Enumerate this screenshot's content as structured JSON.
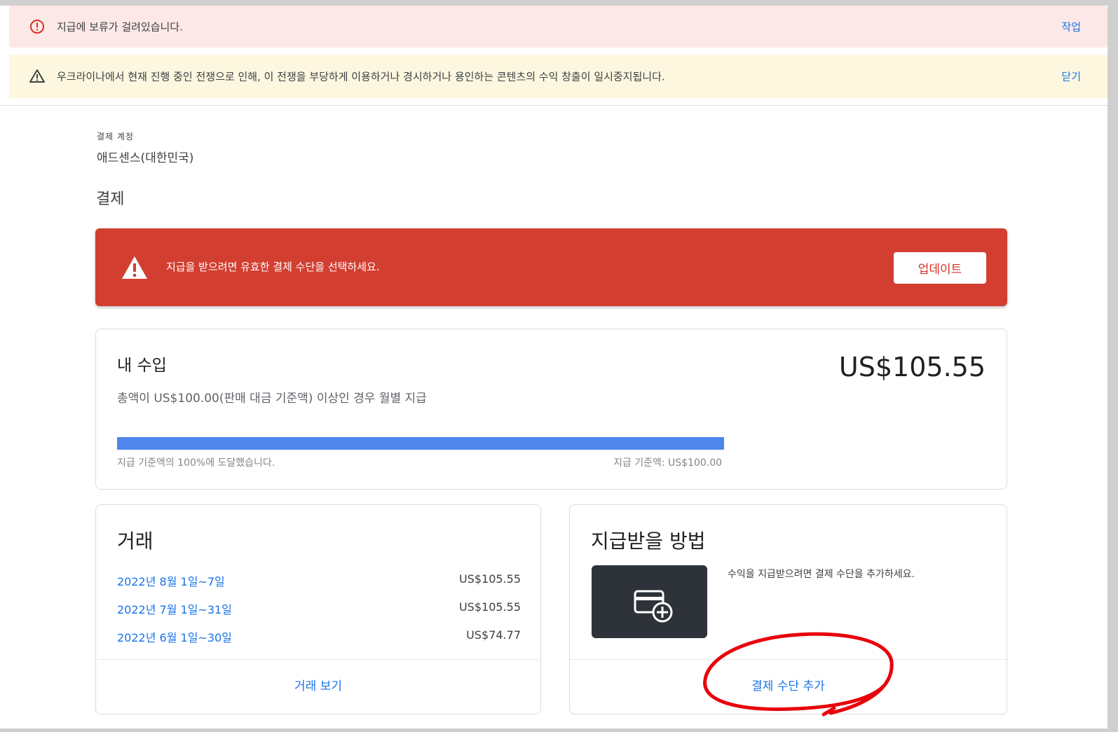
{
  "banners": {
    "error": {
      "text": "지급에 보류가 걸려있습니다.",
      "action": "작업",
      "icon": "error-circle-icon"
    },
    "warning": {
      "text": "우크라이나에서 현재 진행 중인 전쟁으로 인해, 이 전쟁을 부당하게 이용하거나 경시하거나 용인하는 콘텐츠의 수익 창출이 일시중지됩니다.",
      "action": "닫기",
      "icon": "warning-triangle-icon"
    }
  },
  "account": {
    "label": "결제 계정",
    "name": "애드센스(대한민국)"
  },
  "section_title": "결제",
  "alert": {
    "text": "지급을 받으려면 유효한 결제 수단을 선택하세요.",
    "button": "업데이트",
    "color": "#d23f31"
  },
  "earnings": {
    "title": "내 수입",
    "amount": "US$105.55",
    "description": "총액이 US$100.00(판매 대금 기준액) 이상인 경우 월별 지급",
    "progress_percent": 100,
    "progress_left": "지급 기준액의 100%에 도달했습니다.",
    "progress_right": "지급 기준액: US$100.00",
    "bar_color": "#4f86ec"
  },
  "transactions": {
    "title": "거래",
    "rows": [
      {
        "period": "2022년 8월 1일~7일",
        "amount": "US$105.55"
      },
      {
        "period": "2022년 7월 1일~31일",
        "amount": "US$105.55"
      },
      {
        "period": "2022년 6월 1일~30일",
        "amount": "US$74.77"
      }
    ],
    "footer": "거래 보기"
  },
  "payment_method": {
    "title": "지급받을 방법",
    "description": "수익을 지급받으려면 결제 수단을 추가하세요.",
    "icon": "add-card-icon",
    "footer": "결제 수단 추가"
  },
  "colors": {
    "link": "#1a73e8",
    "annotation": "#e8000b"
  }
}
